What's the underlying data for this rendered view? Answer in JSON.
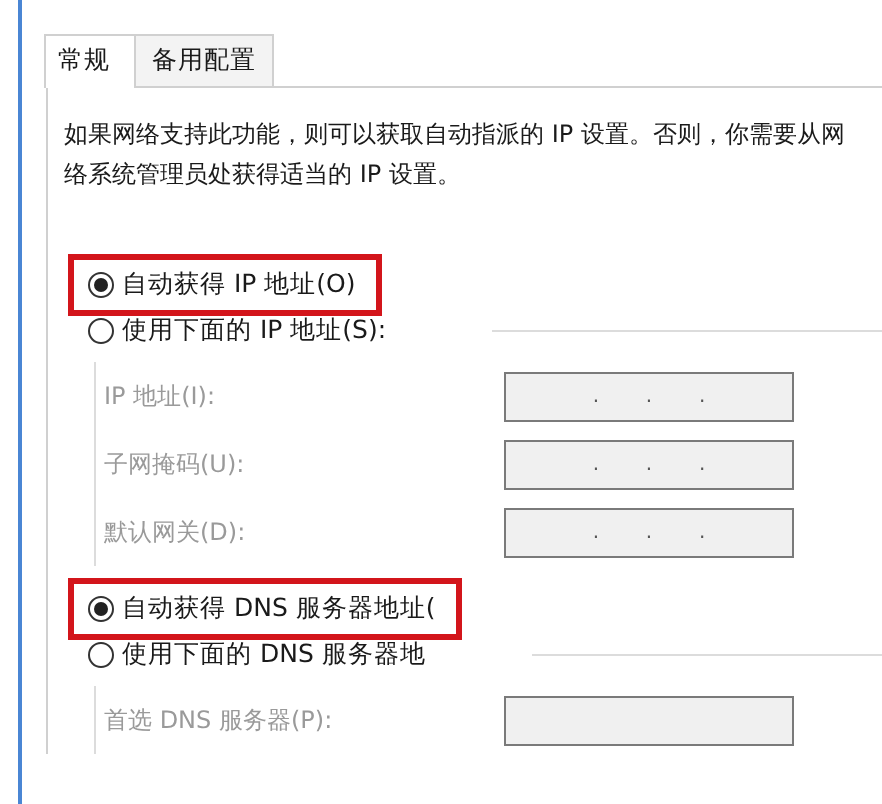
{
  "tabs": [
    {
      "label": "常规",
      "selected": true
    },
    {
      "label": "备用配置",
      "selected": false
    }
  ],
  "description": "如果网络支持此功能，则可以获取自动指派的 IP 设置。否则，你需要从网络系统管理员处获得适当的 IP 设置。",
  "ip_group": {
    "options": [
      {
        "label": "自动获得 IP 地址(O)",
        "selected": true,
        "highlighted": true
      },
      {
        "label": "使用下面的 IP 地址(S):",
        "selected": false,
        "highlighted": false
      }
    ],
    "fields": [
      {
        "label": "IP 地址(I):",
        "disabled": true,
        "separators": [
          ".",
          ".",
          "."
        ]
      },
      {
        "label": "子网掩码(U):",
        "disabled": true,
        "separators": [
          ".",
          ".",
          "."
        ]
      },
      {
        "label": "默认网关(D):",
        "disabled": true,
        "separators": [
          ".",
          ".",
          "."
        ]
      }
    ]
  },
  "dns_group": {
    "options": [
      {
        "label": "自动获得 DNS 服务器地址(",
        "selected": true,
        "highlighted": true
      },
      {
        "label": "使用下面的 DNS 服务器地",
        "selected": false,
        "highlighted": false
      }
    ],
    "fields": [
      {
        "label": "首选 DNS 服务器(P):",
        "disabled": true
      }
    ]
  }
}
